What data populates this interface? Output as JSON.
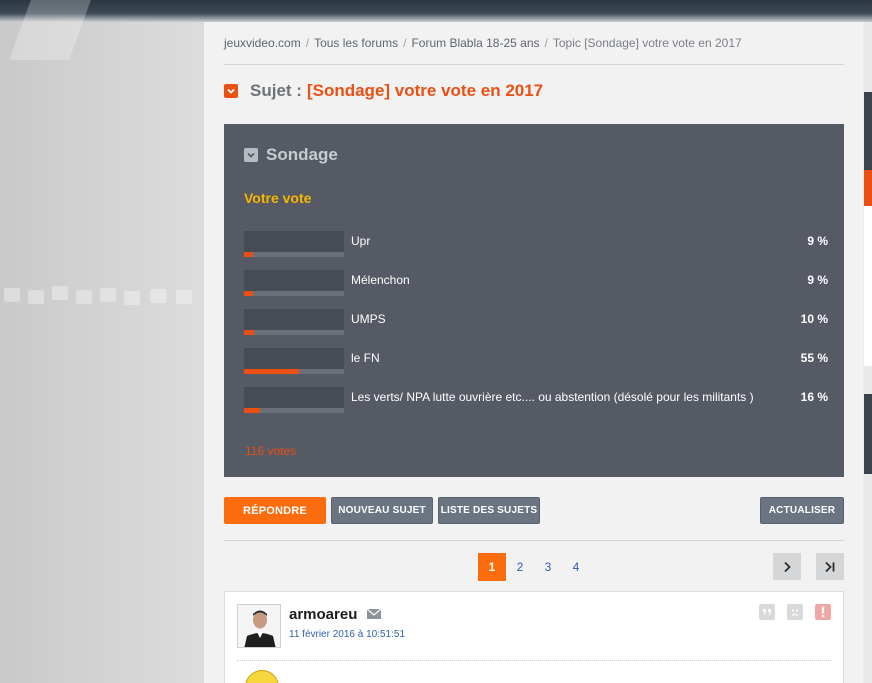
{
  "breadcrumb": {
    "items": [
      "jeuxvideo.com",
      "Tous les forums",
      "Forum Blabla 18-25 ans",
      "Topic [Sondage] votre vote en 2017"
    ],
    "separator": "/"
  },
  "topic": {
    "label": "Sujet :",
    "subject": "[Sondage] votre vote en 2017"
  },
  "poll": {
    "heading": "Sondage",
    "your_vote": "Votre vote",
    "options": [
      {
        "percent_label": "9 %",
        "percent": 9,
        "name": "Upr"
      },
      {
        "percent_label": "9 %",
        "percent": 9,
        "name": "Mélenchon"
      },
      {
        "percent_label": "10 %",
        "percent": 10,
        "name": "UMPS"
      },
      {
        "percent_label": "55 %",
        "percent": 55,
        "name": "le FN"
      },
      {
        "percent_label": "16 %",
        "percent": 16,
        "name": "Les verts/ NPA lutte ouvrière etc.... ou abstention (désolé pour les militants )"
      }
    ],
    "total_votes": "116 votes"
  },
  "actions": {
    "reply": "RÉPONDRE",
    "new_topic": "NOUVEAU SUJET",
    "topic_list": "LISTE DES SUJETS",
    "refresh": "ACTUALISER"
  },
  "pagination": {
    "pages": [
      "1",
      "2",
      "3",
      "4"
    ],
    "current": "1",
    "next_icon": "chevron-right-icon",
    "last_icon": "last-page-icon"
  },
  "post": {
    "author": "armoareu",
    "date": "11 février 2016 à 10:51:51",
    "icons": [
      "mail-icon",
      "quote-icon",
      "sad-face-icon",
      "alert-icon"
    ]
  },
  "colors": {
    "accent": "#ea4f14",
    "reply_button": "#fb6c0f",
    "poll_bg": "#555a64",
    "vote_label": "#f7b600",
    "link": "#2f5fa6"
  }
}
